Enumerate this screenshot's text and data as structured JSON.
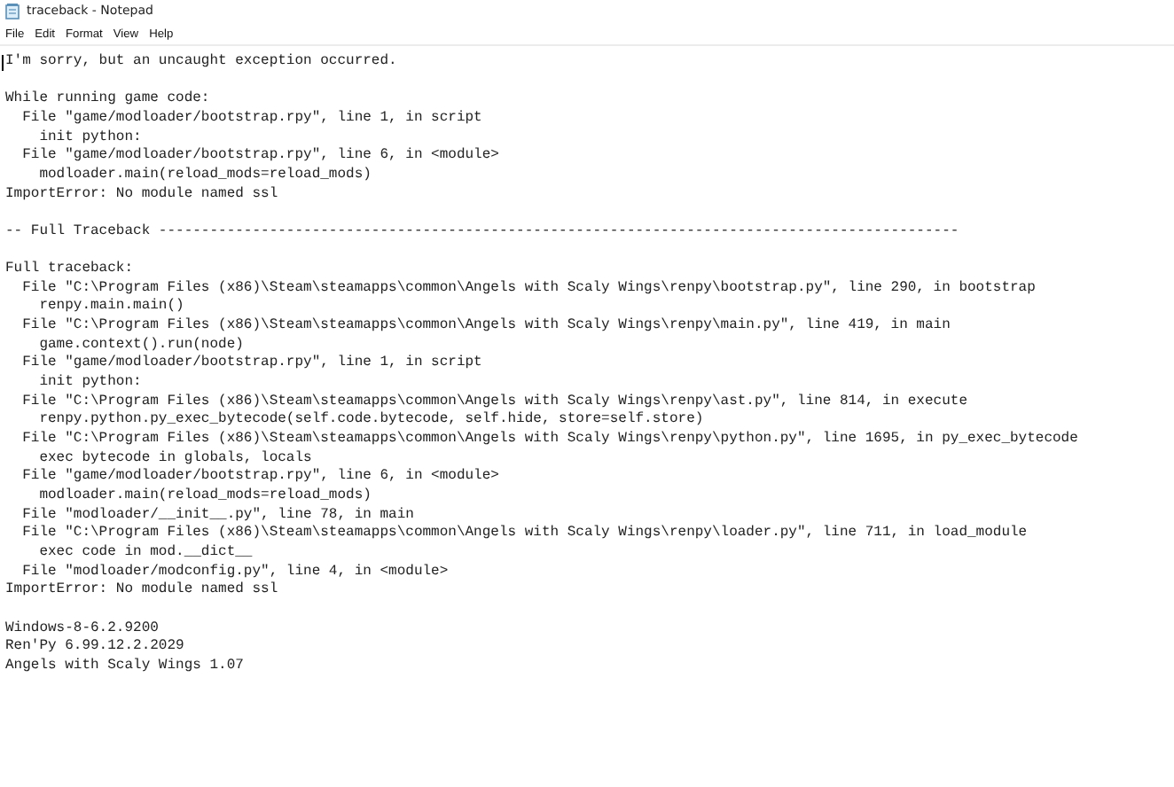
{
  "window": {
    "title": "traceback - Notepad"
  },
  "menu": [
    "File",
    "Edit",
    "Format",
    "View",
    "Help"
  ],
  "blocks": [
    [
      "I'm sorry, but an uncaught exception occurred."
    ],
    [
      "While running game code:",
      "  File \"game/modloader/bootstrap.rpy\", line 1, in script",
      "    init python:",
      "  File \"game/modloader/bootstrap.rpy\", line 6, in <module>",
      "    modloader.main(reload_mods=reload_mods)",
      "ImportError: No module named ssl"
    ],
    [
      "-- Full Traceback ----------------------------------------------------------------------------------------------"
    ],
    [
      "Full traceback:",
      "  File \"C:\\Program Files (x86)\\Steam\\steamapps\\common\\Angels with Scaly Wings\\renpy\\bootstrap.py\", line 290, in bootstrap",
      "    renpy.main.main()",
      "  File \"C:\\Program Files (x86)\\Steam\\steamapps\\common\\Angels with Scaly Wings\\renpy\\main.py\", line 419, in main",
      "    game.context().run(node)",
      "  File \"game/modloader/bootstrap.rpy\", line 1, in script",
      "    init python:",
      "  File \"C:\\Program Files (x86)\\Steam\\steamapps\\common\\Angels with Scaly Wings\\renpy\\ast.py\", line 814, in execute",
      "    renpy.python.py_exec_bytecode(self.code.bytecode, self.hide, store=self.store)",
      "  File \"C:\\Program Files (x86)\\Steam\\steamapps\\common\\Angels with Scaly Wings\\renpy\\python.py\", line 1695, in py_exec_bytecode",
      "    exec bytecode in globals, locals",
      "  File \"game/modloader/bootstrap.rpy\", line 6, in <module>",
      "    modloader.main(reload_mods=reload_mods)",
      "  File \"modloader/__init__.py\", line 78, in main",
      "  File \"C:\\Program Files (x86)\\Steam\\steamapps\\common\\Angels with Scaly Wings\\renpy\\loader.py\", line 711, in load_module",
      "    exec code in mod.__dict__",
      "  File \"modloader/modconfig.py\", line 4, in <module>",
      "ImportError: No module named ssl"
    ],
    [
      "Windows-8-6.2.9200",
      "Ren'Py 6.99.12.2.2029",
      "Angels with Scaly Wings 1.07"
    ]
  ]
}
